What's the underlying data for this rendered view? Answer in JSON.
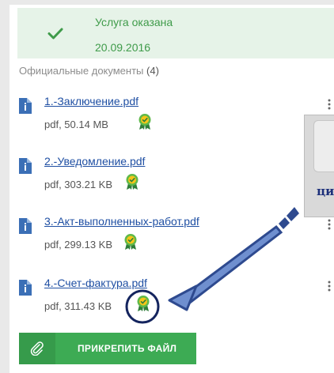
{
  "status": {
    "title": "Услуга оказана",
    "date": "20.09.2016",
    "color": "#3f9b4a",
    "icon": "check-icon",
    "edit_icon": "pencil-icon"
  },
  "documents_section": {
    "label": "Официальные документы",
    "count": "(4)"
  },
  "documents": [
    {
      "name": "1.-Заключение.pdf",
      "meta": "pdf, 50.14 MB",
      "icon": "pdf-file-icon",
      "signed": true
    },
    {
      "name": "2.-Уведомление.pdf",
      "meta": "pdf, 303.21 KB",
      "icon": "pdf-file-icon",
      "signed": true
    },
    {
      "name": "3.-Акт-выполненных-работ.pdf",
      "meta": "pdf, 299.13 KB",
      "icon": "pdf-file-icon",
      "signed": true
    },
    {
      "name": "4.-Счет-фактура.pdf",
      "meta": "pdf, 311.43 KB",
      "icon": "pdf-file-icon",
      "signed": true
    }
  ],
  "attach_button": {
    "label": "ПРИКРЕПИТЬ ФАЙЛ",
    "icon": "paperclip-icon",
    "color": "#3dab54"
  },
  "tooltip": {
    "text": "ци"
  },
  "annotation": {
    "arrow_color": "#2e4a8f",
    "circle_color": "#14245e"
  }
}
